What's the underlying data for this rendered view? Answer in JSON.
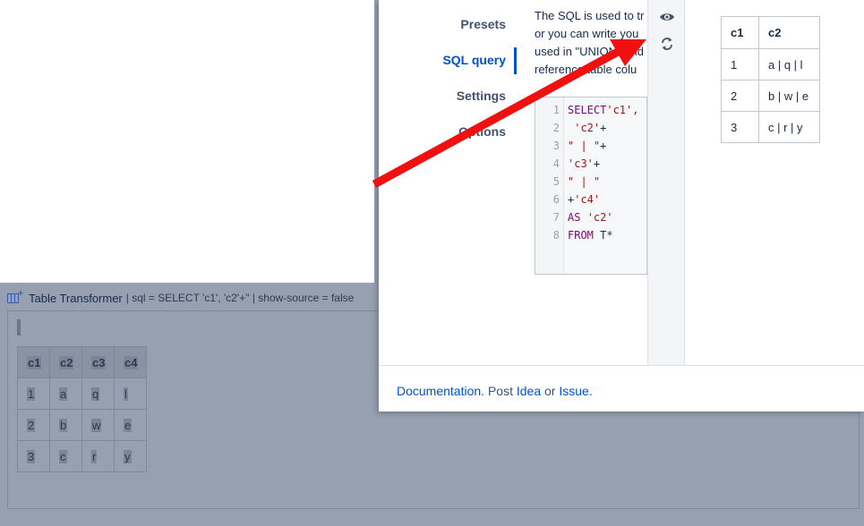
{
  "macro": {
    "name": "Table Transformer",
    "params": "| sql = SELECT 'c1', 'c2'+\" | show-source = false",
    "table": {
      "headers": [
        "c1",
        "c2",
        "c3",
        "c4"
      ],
      "rows": [
        [
          "1",
          "a",
          "q",
          "l"
        ],
        [
          "2",
          "b",
          "w",
          "e"
        ],
        [
          "3",
          "c",
          "r",
          "y"
        ]
      ]
    }
  },
  "dialog": {
    "nav": [
      "Presets",
      "SQL query",
      "Settings",
      "Options"
    ],
    "active_nav": "SQL query",
    "description": [
      "The SQL is used to tr",
      "or you can write you",
      "used in \"UNION\" and",
      "reference table colu"
    ],
    "sql_lines": [
      [
        {
          "t": "SELECT",
          "c": "kw"
        },
        {
          "t": "'c1',",
          "c": "str"
        }
      ],
      [
        {
          "t": " 'c2'",
          "c": "str"
        },
        {
          "t": "+",
          "c": "pl"
        }
      ],
      [
        {
          "t": "\" | \"",
          "c": "str"
        },
        {
          "t": "+",
          "c": "pl"
        }
      ],
      [
        {
          "t": "'c3'",
          "c": "str"
        },
        {
          "t": "+",
          "c": "pl"
        }
      ],
      [
        {
          "t": "\" | \"",
          "c": "str"
        }
      ],
      [
        {
          "t": "+",
          "c": "pl"
        },
        {
          "t": "'c4'",
          "c": "str"
        }
      ],
      [
        {
          "t": "AS ",
          "c": "kw"
        },
        {
          "t": "'c2'",
          "c": "str"
        }
      ],
      [
        {
          "t": "FROM ",
          "c": "kw"
        },
        {
          "t": "T*",
          "c": "pl"
        }
      ]
    ],
    "icons": {
      "preview": "eye-icon",
      "refresh": "refresh-icon"
    },
    "preview_table": {
      "headers": [
        "c1",
        "c2"
      ],
      "rows": [
        [
          "1",
          "a | q | l"
        ],
        [
          "2",
          "b | w | e"
        ],
        [
          "3",
          "c | r | y"
        ]
      ]
    },
    "footer": {
      "documentation": "Documentation",
      "dot": ".",
      "post": " Post ",
      "idea": "Idea",
      "or": " or ",
      "issue": "Issue",
      "end": "."
    }
  },
  "colors": {
    "accent": "#0052cc",
    "arrow": "#f20f0f",
    "overlay": "#97a0b1"
  }
}
